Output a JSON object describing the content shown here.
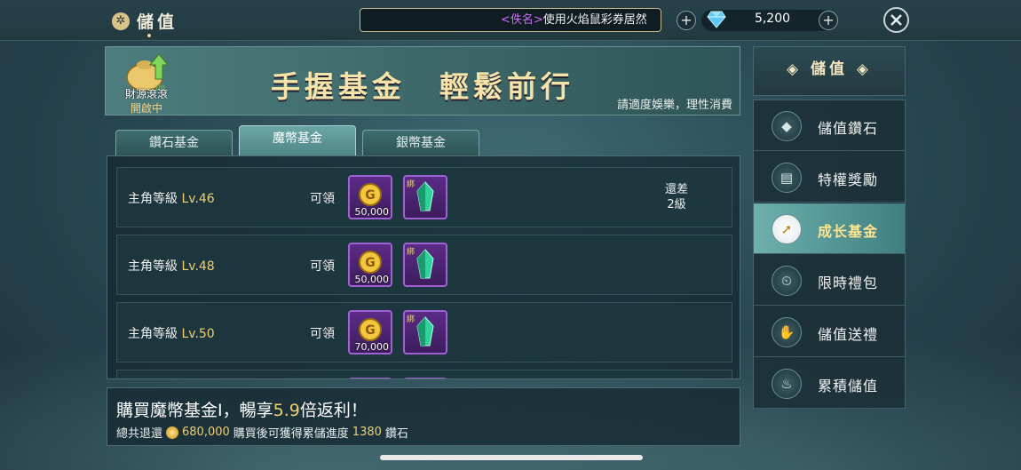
{
  "topbar": {
    "title": "儲值",
    "marquee_name": "<佚名>",
    "marquee_message": "使用火焰鼠彩券居然",
    "diamond_count": "5,200",
    "plus_symbol": "+"
  },
  "banner": {
    "icon_label": "財源滾滾",
    "icon_sub": "開啟中",
    "headline": "手握基金　輕鬆前行",
    "note": "請適度娛樂，理性消費"
  },
  "tabs": [
    {
      "label": "鑽石基金",
      "active": false
    },
    {
      "label": "魔幣基金",
      "active": true
    },
    {
      "label": "銀幣基金",
      "active": false
    }
  ],
  "rows": [
    {
      "level_prefix": "主角等級 ",
      "level": "Lv.46",
      "status": "可領",
      "coin_qty": "50,000",
      "bound_tag": "綁",
      "remain": "還差\n2級"
    },
    {
      "level_prefix": "主角等級 ",
      "level": "Lv.48",
      "status": "可領",
      "coin_qty": "50,000",
      "bound_tag": "綁",
      "remain": ""
    },
    {
      "level_prefix": "主角等級 ",
      "level": "Lv.50",
      "status": "可領",
      "coin_qty": "70,000",
      "bound_tag": "綁",
      "remain": ""
    }
  ],
  "footer": {
    "buy_prefix": "購買魔幣基金I，暢享",
    "buy_multiplier": "5.9",
    "buy_suffix": "倍返利！",
    "total_prefix": "總共退還",
    "total_amount": "680,000",
    "progress_prefix": "購買後可獲得累儲進度",
    "progress_value": "1380",
    "progress_suffix": "鑽石"
  },
  "sidebar": {
    "title": "儲值",
    "items": [
      {
        "label": "儲值鑽石",
        "icon": "diamond-icon",
        "active": false
      },
      {
        "label": "特權獎勵",
        "icon": "treasure-chest-icon",
        "active": false
      },
      {
        "label": "成长基金",
        "icon": "growth-arrow-icon",
        "active": true
      },
      {
        "label": "限時禮包",
        "icon": "gift-clock-icon",
        "active": false
      },
      {
        "label": "儲值送禮",
        "icon": "gift-hand-icon",
        "active": false
      },
      {
        "label": "累積儲值",
        "icon": "piggy-bank-icon",
        "active": false
      }
    ]
  },
  "colors": {
    "accent_gold": "#f1cf72",
    "rare_purple": "#a061d6",
    "active_teal": "#6db0ad"
  }
}
